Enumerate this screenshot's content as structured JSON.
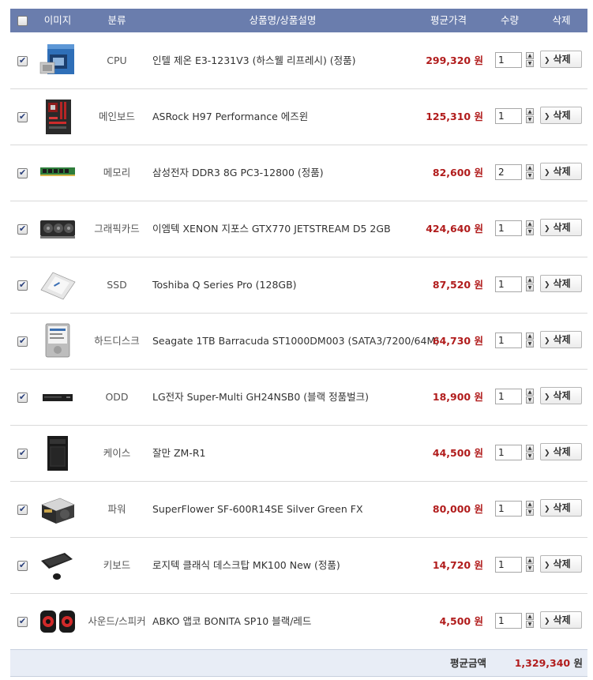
{
  "header": {
    "col_image": "이미지",
    "col_category": "분류",
    "col_name": "상품명/상품설명",
    "col_price": "평균가격",
    "col_qty": "수량",
    "col_delete": "삭제"
  },
  "currency_unit": "원",
  "delete_label": "삭제",
  "items": [
    {
      "category": "CPU",
      "name": "인텔 제온 E3-1231V3 (하스웰 리프레시) (정품)",
      "price": "299,320",
      "qty": "1",
      "checked": true,
      "icon": "cpu-box-icon"
    },
    {
      "category": "메인보드",
      "name": "ASRock H97 Performance 에즈윈",
      "price": "125,310",
      "qty": "1",
      "checked": true,
      "icon": "motherboard-icon"
    },
    {
      "category": "메모리",
      "name": "삼성전자 DDR3 8G PC3-12800 (정품)",
      "price": "82,600",
      "qty": "2",
      "checked": true,
      "icon": "ram-stick-icon"
    },
    {
      "category": "그래픽카드",
      "name": "이엠텍 XENON 지포스 GTX770 JETSTREAM D5 2GB",
      "price": "424,640",
      "qty": "1",
      "checked": true,
      "icon": "graphics-card-icon"
    },
    {
      "category": "SSD",
      "name": "Toshiba Q Series Pro (128GB)",
      "price": "87,520",
      "qty": "1",
      "checked": true,
      "icon": "ssd-icon"
    },
    {
      "category": "하드디스크",
      "name": "Seagate 1TB Barracuda ST1000DM003 (SATA3/7200/64M)",
      "price": "64,730",
      "qty": "1",
      "checked": true,
      "icon": "hard-disk-icon"
    },
    {
      "category": "ODD",
      "name": "LG전자 Super-Multi GH24NSB0 (블랙 정품벌크)",
      "price": "18,900",
      "qty": "1",
      "checked": true,
      "icon": "optical-drive-icon"
    },
    {
      "category": "케이스",
      "name": "잘만 ZM-R1",
      "price": "44,500",
      "qty": "1",
      "checked": true,
      "icon": "pc-case-icon"
    },
    {
      "category": "파워",
      "name": "SuperFlower SF-600R14SE Silver Green FX",
      "price": "80,000",
      "qty": "1",
      "checked": true,
      "icon": "power-supply-icon"
    },
    {
      "category": "키보드",
      "name": "로지텍 클래식 데스크탑 MK100 New (정품)",
      "price": "14,720",
      "qty": "1",
      "checked": true,
      "icon": "keyboard-mouse-icon"
    },
    {
      "category": "사운드/스피커",
      "name": "ABKO 앱코 BONITA SP10 블랙/레드",
      "price": "4,500",
      "qty": "1",
      "checked": true,
      "icon": "speakers-icon"
    }
  ],
  "total": {
    "label": "평균금액",
    "value": "1,329,340",
    "unit": "원"
  }
}
